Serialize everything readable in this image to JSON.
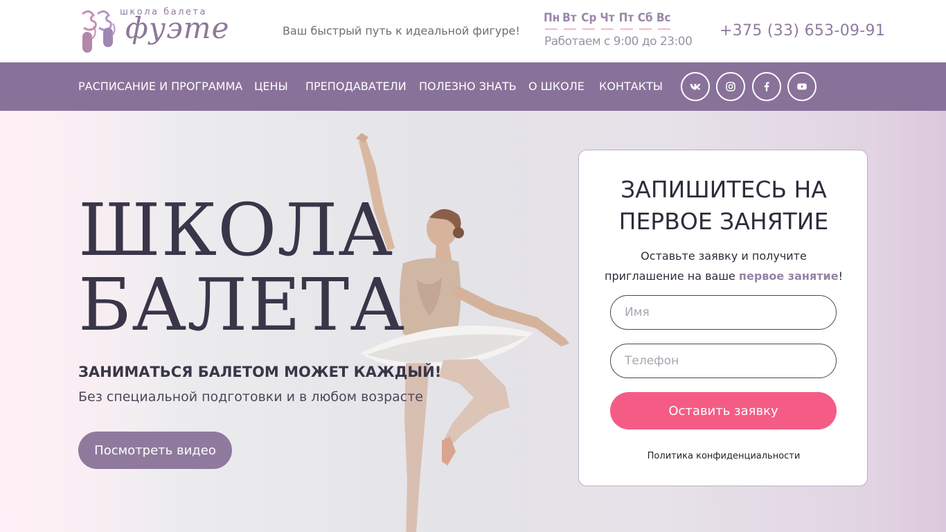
{
  "header": {
    "logo_small": "школа балета",
    "logo_main": "фуэте",
    "tagline": "Ваш быстрый путь к идеальной фигуре!",
    "days": [
      "Пн",
      "Вт",
      "Ср",
      "Чт",
      "Пт",
      "Сб",
      "Вс"
    ],
    "hours": "Работаем с 9:00 до 23:00",
    "phone": "+375 (33) 653-09-91"
  },
  "nav": {
    "items": [
      "РАСПИСАНИЕ И ПРОГРАММА",
      "ЦЕНЫ",
      "ПРЕПОДАВАТЕЛИ",
      "ПОЛЕЗНО ЗНАТЬ",
      "О ШКОЛЕ",
      "КОНТАКТЫ"
    ],
    "social": [
      "vk-icon",
      "instagram-icon",
      "facebook-icon",
      "youtube-icon"
    ]
  },
  "hero": {
    "title_line1": "ШКОЛА",
    "title_line2": "БАЛЕТА",
    "subtitle": "ЗАНИМАТЬСЯ БАЛЕТОМ МОЖЕТ КАЖДЫЙ!",
    "subtitle2": "Без специальной подготовки и в любом возрасте",
    "video_button": "Посмотреть видео"
  },
  "form": {
    "title_line1": "ЗАПИШИТЕСЬ НА",
    "title_line2": "ПЕРВОЕ ЗАНЯТИЕ",
    "text_part1": "Оставьте заявку и получите приглашение на ваше ",
    "text_highlight": "первое занятие",
    "text_part2": "!",
    "name_placeholder": "Имя",
    "phone_placeholder": "Телефон",
    "submit_label": "Оставить заявку",
    "privacy": "Политика конфиденциальности"
  },
  "colors": {
    "brand_purple": "#89729a",
    "accent_pink": "#f45c86",
    "text_dark": "#3a3548"
  }
}
